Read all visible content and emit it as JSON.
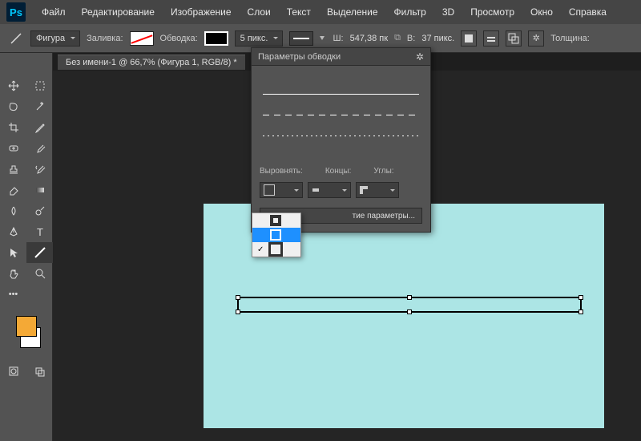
{
  "menu": [
    "Файл",
    "Редактирование",
    "Изображение",
    "Слои",
    "Текст",
    "Выделение",
    "Фильтр",
    "3D",
    "Просмотр",
    "Окно",
    "Справка"
  ],
  "optionsBar": {
    "shapeMode": "Фигура",
    "fillLabel": "Заливка:",
    "strokeLabel": "Обводка:",
    "strokeWidth": "5 пикс.",
    "wLabel": "Ш:",
    "wValue": "547,38 пк",
    "hLabel": "В:",
    "hValue": "37 пикс.",
    "thicknessLabel": "Толщина:"
  },
  "docTab": "Без имени-1 @ 66,7% (Фигура 1, RGB/8) *",
  "strokePanel": {
    "title": "Параметры обводки",
    "alignLabel": "Выровнять:",
    "capsLabel": "Концы:",
    "cornersLabel": "Углы:",
    "moreLabel": "тие параметры..."
  },
  "canvas": {
    "bg": "#ace5e5"
  }
}
